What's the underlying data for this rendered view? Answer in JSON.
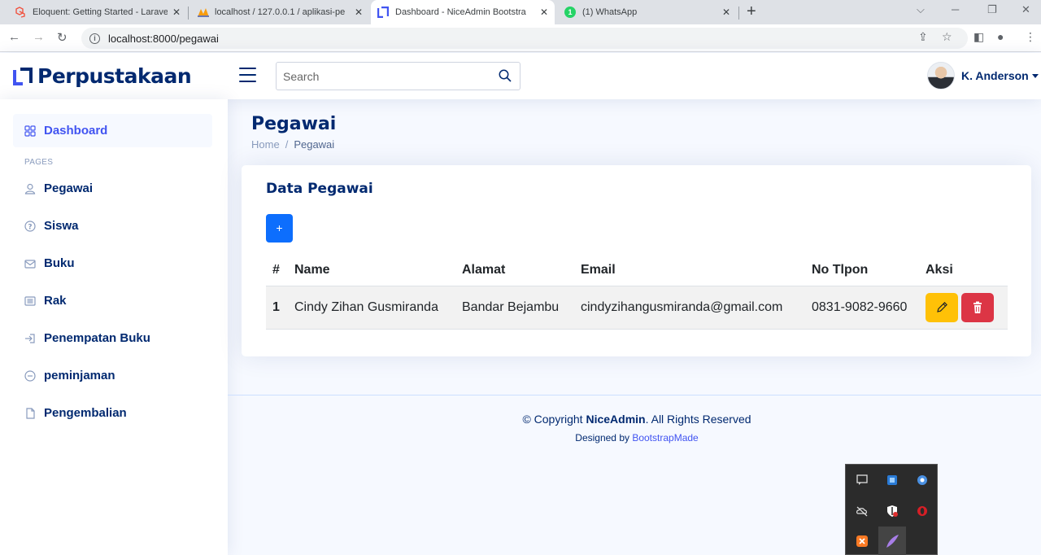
{
  "browser": {
    "tabs": [
      {
        "title": "Eloquent: Getting Started - Larave",
        "color": "#f05340"
      },
      {
        "title": "localhost / 127.0.0.1 / aplikasi-pe",
        "color": "#f89c0e"
      },
      {
        "title": "Dashboard - NiceAdmin Bootstra",
        "color": "#4154f1"
      },
      {
        "title": "(1) WhatsApp",
        "color": "#25d366",
        "badge": "1"
      }
    ],
    "new_tab": "+",
    "url": "localhost:8000/pegawai"
  },
  "header": {
    "logo_text": "Perpustakaan",
    "search_placeholder": "Search",
    "user_name": "K. Anderson"
  },
  "sidebar": {
    "items": [
      {
        "label": "Dashboard",
        "icon": "grid-icon"
      },
      {
        "label": "Pegawai",
        "icon": "person-icon"
      },
      {
        "label": "Siswa",
        "icon": "question-circle-icon"
      },
      {
        "label": "Buku",
        "icon": "envelope-icon"
      },
      {
        "label": "Rak",
        "icon": "list-icon"
      },
      {
        "label": "Penempatan Buku",
        "icon": "box-arrow-in-icon"
      },
      {
        "label": "peminjaman",
        "icon": "dash-circle-icon"
      },
      {
        "label": "Pengembalian",
        "icon": "file-icon"
      }
    ],
    "heading": "Pages"
  },
  "main": {
    "title": "Pegawai",
    "breadcrumb": {
      "home": "Home",
      "sep": "/",
      "current": "Pegawai"
    },
    "card_title": "Data Pegawai",
    "add_label": "+",
    "table": {
      "headers": [
        "#",
        "Name",
        "Alamat",
        "Email",
        "No Tlpon",
        "Aksi"
      ],
      "rows": [
        {
          "no": "1",
          "name": "Cindy Zihan Gusmiranda",
          "alamat": "Bandar Bejambu",
          "email": "cindyzihangusmiranda@gmail.com",
          "tlp": "0831-9082-9660"
        }
      ]
    }
  },
  "footer": {
    "copyright_pre": "© Copyright ",
    "copyright_brand": "NiceAdmin",
    "copyright_post": ". All Rights Reserved",
    "designed_by": "Designed by ",
    "designer": "BootstrapMade"
  },
  "colors": {
    "primary": "#4154f1",
    "navy": "#012970",
    "warning": "#ffc107",
    "danger": "#dc3545",
    "add": "#0d6efd"
  }
}
